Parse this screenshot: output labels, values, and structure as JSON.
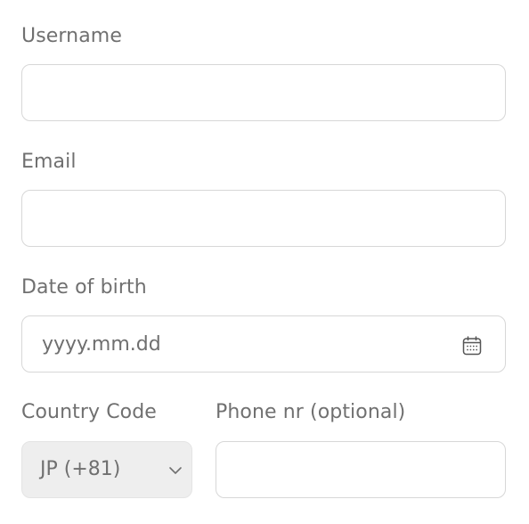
{
  "form": {
    "username": {
      "label": "Username",
      "value": "",
      "placeholder": ""
    },
    "email": {
      "label": "Email",
      "value": "",
      "placeholder": ""
    },
    "date_of_birth": {
      "label": "Date of birth",
      "value": "",
      "placeholder": "yyyy.mm.dd",
      "icon": "calendar-icon"
    },
    "country_code": {
      "label": "Country Code",
      "selected": "JP (+81)",
      "icon": "chevron-down-icon"
    },
    "phone": {
      "label": "Phone nr (optional)",
      "value": "",
      "placeholder": ""
    }
  },
  "colors": {
    "label_text": "#707070",
    "field_border": "#d7d7d7",
    "select_background": "#eeeeee",
    "page_background": "#ffffff"
  }
}
